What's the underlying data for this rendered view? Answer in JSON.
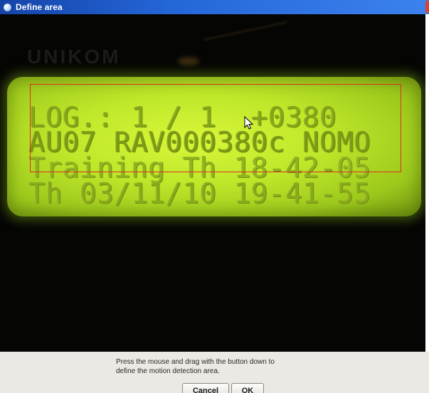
{
  "window": {
    "title": "Define area"
  },
  "camera_view": {
    "background_brand": "UNIKOM",
    "lcd_lines": [
      "LOG.: 1 / 1  +0380",
      "AU07 RAV000380c NOMO",
      "Training Th 18-42-05",
      "Th 03/11/10 19-41-55"
    ],
    "selection_color": "#d8321e",
    "lcd_color": "#c6ec2c"
  },
  "footer": {
    "instruction_line1": "Press the mouse and drag with the button down to",
    "instruction_line2": "define the motion detection area.",
    "cancel_label": "Cancel",
    "ok_label": "OK"
  },
  "icons": {
    "title": "app-icon",
    "cursor": "mouse-pointer-icon"
  }
}
